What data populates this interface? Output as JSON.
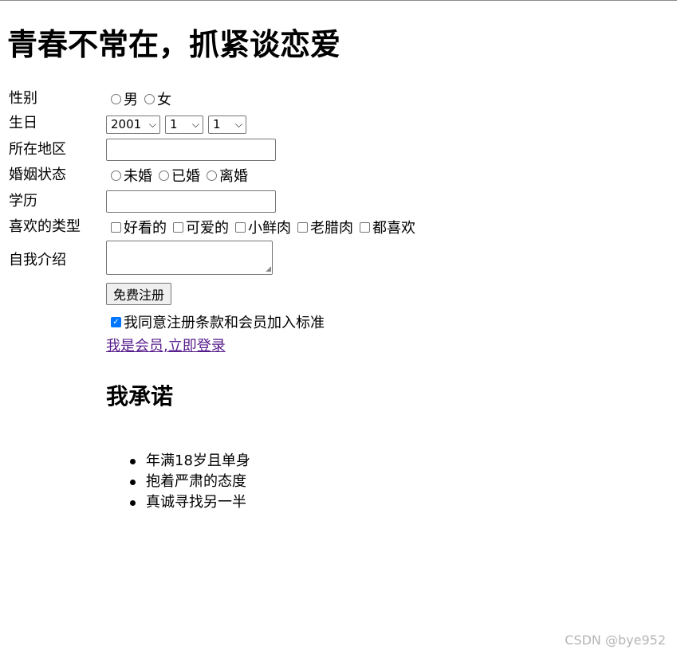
{
  "page": {
    "title": "青春不常在，抓紧谈恋爱"
  },
  "form": {
    "gender": {
      "label": "性别",
      "options": [
        "男",
        "女"
      ]
    },
    "birthday": {
      "label": "生日",
      "year": "2001",
      "month": "1",
      "day": "1"
    },
    "region": {
      "label": "所在地区",
      "value": ""
    },
    "marital": {
      "label": "婚姻状态",
      "options": [
        "未婚",
        "已婚",
        "离婚"
      ]
    },
    "education": {
      "label": "学历",
      "value": ""
    },
    "preference": {
      "label": "喜欢的类型",
      "options": [
        "好看的",
        "可爱的",
        "小鲜肉",
        "老腊肉",
        "都喜欢"
      ]
    },
    "intro": {
      "label": "自我介绍",
      "value": ""
    },
    "submit_label": "免费注册",
    "agree": {
      "label": "我同意注册条款和会员加入标准",
      "checked": true
    },
    "login_link": "我是会员,立即登录"
  },
  "promise": {
    "heading": "我承诺",
    "items": [
      "年满18岁且单身",
      "抱着严肃的态度",
      "真诚寻找另一半"
    ]
  },
  "watermark": "CSDN @bye952"
}
